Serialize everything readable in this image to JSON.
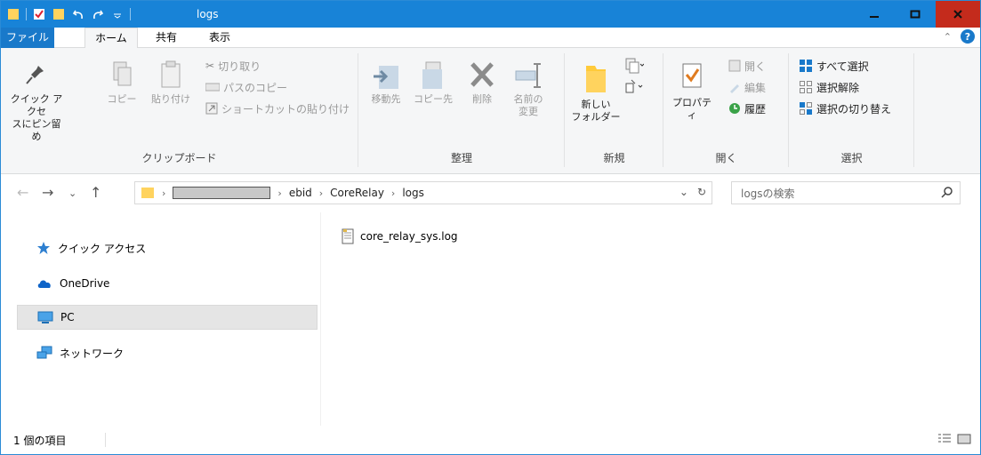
{
  "window": {
    "title": "logs",
    "accent": "#1883d7",
    "close_color": "#c42b1c"
  },
  "quick_access_toolbar": {
    "icons": [
      "folder-icon",
      "properties-check-icon",
      "new-folder-icon",
      "undo-icon",
      "redo-icon",
      "dropdown-icon"
    ]
  },
  "ribbon_tabs": {
    "file": "ファイル",
    "home": "ホーム",
    "share": "共有",
    "view": "表示"
  },
  "ribbon": {
    "clipboard": {
      "label": "クリップボード",
      "pin_line1": "クイック アクセ",
      "pin_line2": "スにピン留め",
      "copy": "コピー",
      "paste": "貼り付け",
      "cut": "切り取り",
      "copy_path": "パスのコピー",
      "paste_shortcut": "ショートカットの貼り付け"
    },
    "organize": {
      "label": "整理",
      "move_to": "移動先",
      "copy_to": "コピー先",
      "delete": "削除",
      "rename_line1": "名前の",
      "rename_line2": "変更"
    },
    "new": {
      "label": "新規",
      "new_folder_line1": "新しい",
      "new_folder_line2": "フォルダー"
    },
    "open": {
      "label": "開く",
      "properties": "プロパティ",
      "open": "開く",
      "edit": "編集",
      "history": "履歴"
    },
    "select": {
      "label": "選択",
      "select_all": "すべて選択",
      "select_none": "選択解除",
      "invert": "選択の切り替え"
    }
  },
  "address_bar": {
    "crumbs": [
      "ebid",
      "CoreRelay",
      "logs"
    ],
    "search_placeholder": "logsの検索"
  },
  "nav_pane": {
    "items": [
      {
        "label": "クイック アクセス",
        "icon": "star-icon"
      },
      {
        "label": "OneDrive",
        "icon": "cloud-icon"
      },
      {
        "label": "PC",
        "icon": "computer-icon",
        "selected": true
      },
      {
        "label": "ネットワーク",
        "icon": "network-icon"
      }
    ]
  },
  "files": [
    {
      "name": "core_relay_sys.log",
      "icon": "log-file-icon"
    }
  ],
  "status_bar": {
    "item_count": "1 個の項目"
  }
}
